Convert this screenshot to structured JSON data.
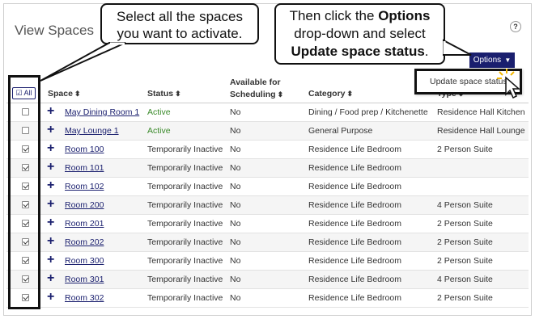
{
  "page_title": "View Spaces",
  "help_label": "?",
  "options_button": "Options",
  "dropdown_item": "Update space status",
  "all_button": "All",
  "headers": {
    "space": "Space",
    "status": "Status",
    "available_line1": "Available for",
    "available_line2": "Scheduling",
    "category": "Category",
    "type": "Type"
  },
  "rows": [
    {
      "checked": false,
      "space": "May Dining Room 1",
      "status": "Active",
      "available": "No",
      "category": "Dining / Food prep / Kitchenette",
      "type": "Residence Hall Kitchen"
    },
    {
      "checked": false,
      "space": "May Lounge 1",
      "status": "Active",
      "available": "No",
      "category": "General Purpose",
      "type": "Residence Hall Lounge"
    },
    {
      "checked": true,
      "space": "Room 100",
      "status": "Temporarily Inactive",
      "available": "No",
      "category": "Residence Life Bedroom",
      "type": "2 Person Suite"
    },
    {
      "checked": true,
      "space": "Room 101",
      "status": "Temporarily Inactive",
      "available": "No",
      "category": "Residence Life Bedroom",
      "type": ""
    },
    {
      "checked": true,
      "space": "Room 102",
      "status": "Temporarily Inactive",
      "available": "No",
      "category": "Residence Life Bedroom",
      "type": ""
    },
    {
      "checked": true,
      "space": "Room 200",
      "status": "Temporarily Inactive",
      "available": "No",
      "category": "Residence Life Bedroom",
      "type": "4 Person Suite"
    },
    {
      "checked": true,
      "space": "Room 201",
      "status": "Temporarily Inactive",
      "available": "No",
      "category": "Residence Life Bedroom",
      "type": "2 Person Suite"
    },
    {
      "checked": true,
      "space": "Room 202",
      "status": "Temporarily Inactive",
      "available": "No",
      "category": "Residence Life Bedroom",
      "type": "2 Person Suite"
    },
    {
      "checked": true,
      "space": "Room 300",
      "status": "Temporarily Inactive",
      "available": "No",
      "category": "Residence Life Bedroom",
      "type": "2 Person Suite"
    },
    {
      "checked": true,
      "space": "Room 301",
      "status": "Temporarily Inactive",
      "available": "No",
      "category": "Residence Life Bedroom",
      "type": "4 Person Suite"
    },
    {
      "checked": true,
      "space": "Room 302",
      "status": "Temporarily Inactive",
      "available": "No",
      "category": "Residence Life Bedroom",
      "type": "2 Person Suite"
    }
  ],
  "callouts": {
    "select_line1": "Select all the spaces",
    "select_line2": "you want to activate.",
    "options_line1_a": "Then click the ",
    "options_line1_b": "Options",
    "options_line2": "drop-down and select",
    "options_line3_a": "Update space status",
    "options_line3_b": "."
  },
  "colors": {
    "brand": "#1a1f6e",
    "active": "#3a8a2a"
  }
}
